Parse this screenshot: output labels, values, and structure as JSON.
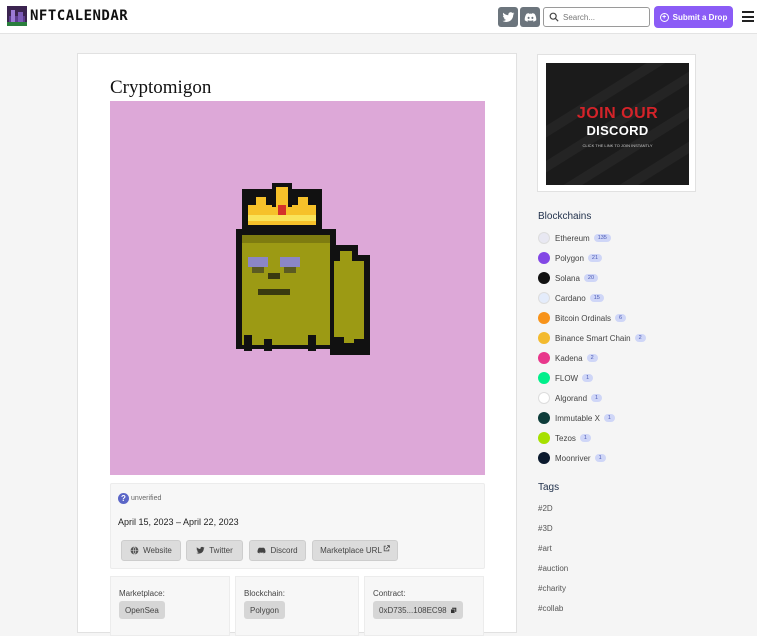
{
  "header": {
    "logo_text": "NFTCALENDAR",
    "search_placeholder": "Search...",
    "submit_label": "Submit a Drop"
  },
  "project": {
    "title": "Cryptomigon",
    "status": "unverified",
    "dates": "April 15, 2023 – April 22, 2023",
    "links": [
      {
        "label": "Website",
        "icon": "globe-icon"
      },
      {
        "label": "Twitter",
        "icon": "twitter-icon"
      },
      {
        "label": "Discord",
        "icon": "discord-icon"
      },
      {
        "label": "Marketplace URL",
        "icon": "external-link-icon"
      }
    ],
    "meta": {
      "marketplace_label": "Marketplace:",
      "marketplace_value": "OpenSea",
      "blockchain_label": "Blockchain:",
      "blockchain_value": "Polygon",
      "contract_label": "Contract:",
      "contract_value": "0xD735...108EC98"
    }
  },
  "ad": {
    "line1": "JOIN OUR",
    "line2": "DISCORD",
    "line3": "CLICK THE LINK TO JOIN INSTANTLY"
  },
  "sidebar": {
    "blockchains_heading": "Blockchains",
    "blockchains": [
      {
        "name": "Ethereum",
        "count": "135",
        "color": "#e8e8f2"
      },
      {
        "name": "Polygon",
        "count": "21",
        "color": "#8247e5"
      },
      {
        "name": "Solana",
        "count": "20",
        "color": "#111111"
      },
      {
        "name": "Cardano",
        "count": "15",
        "color": "#e4ecfb"
      },
      {
        "name": "Bitcoin Ordinals",
        "count": "6",
        "color": "#f7931a"
      },
      {
        "name": "Binance Smart Chain",
        "count": "2",
        "color": "#f3ba2f"
      },
      {
        "name": "Kadena",
        "count": "2",
        "color": "#e8378b"
      },
      {
        "name": "FLOW",
        "count": "1",
        "color": "#00ef8b"
      },
      {
        "name": "Algorand",
        "count": "1",
        "color": "#ffffff"
      },
      {
        "name": "Immutable X",
        "count": "1",
        "color": "#0e3c3a"
      },
      {
        "name": "Tezos",
        "count": "1",
        "color": "#a6e000"
      },
      {
        "name": "Moonriver",
        "count": "1",
        "color": "#0b1a2e"
      }
    ],
    "tags_heading": "Tags",
    "tags": [
      "#2D",
      "#3D",
      "#art",
      "#auction",
      "#charity",
      "#collab"
    ]
  }
}
